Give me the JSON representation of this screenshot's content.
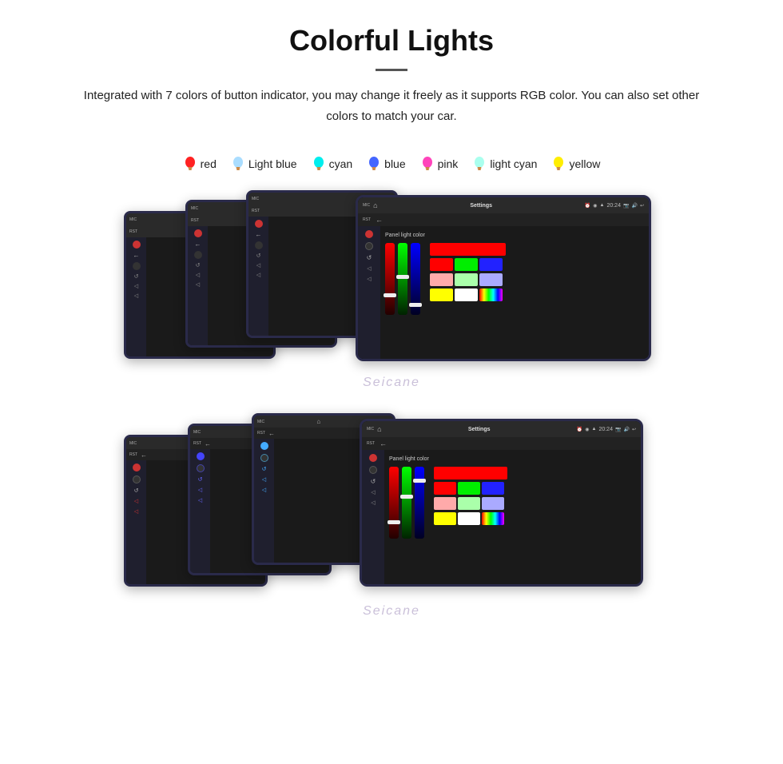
{
  "header": {
    "title": "Colorful Lights",
    "description": "Integrated with 7 colors of button indicator, you may change it freely as it supports RGB color. You can also set other colors to match your car.",
    "colors": [
      {
        "name": "red",
        "color": "#ff2222",
        "glow": "#ff4444"
      },
      {
        "name": "Light blue",
        "color": "#44aaff",
        "glow": "#88ccff"
      },
      {
        "name": "cyan",
        "color": "#00ffff",
        "glow": "#00dddd"
      },
      {
        "name": "blue",
        "color": "#2244ff",
        "glow": "#4466ff"
      },
      {
        "name": "pink",
        "color": "#ff44aa",
        "glow": "#ff66cc"
      },
      {
        "name": "light cyan",
        "color": "#aaffee",
        "glow": "#88ffee"
      },
      {
        "name": "yellow",
        "color": "#ffee00",
        "glow": "#ffdd00"
      }
    ]
  },
  "devices": {
    "topRow": {
      "settingsTitle": "Settings",
      "panelLightLabel": "Panel light color",
      "colorGrid": [
        [
          "#ff0000",
          "#00ff00",
          "#0000ff"
        ],
        [
          "#ff0000",
          "#00ff00",
          "#0000ff"
        ],
        [
          "#ffaaaa",
          "#aaffaa",
          "#aaaaff"
        ],
        [
          "#ffff00",
          "#ffffff",
          "rainbow"
        ]
      ],
      "timeLabel": "20:24"
    },
    "bottomRow": {
      "settingsTitle": "Settings",
      "panelLightLabel": "Panel light color",
      "timeLabel": "20:24"
    }
  },
  "watermark": "Seicane"
}
